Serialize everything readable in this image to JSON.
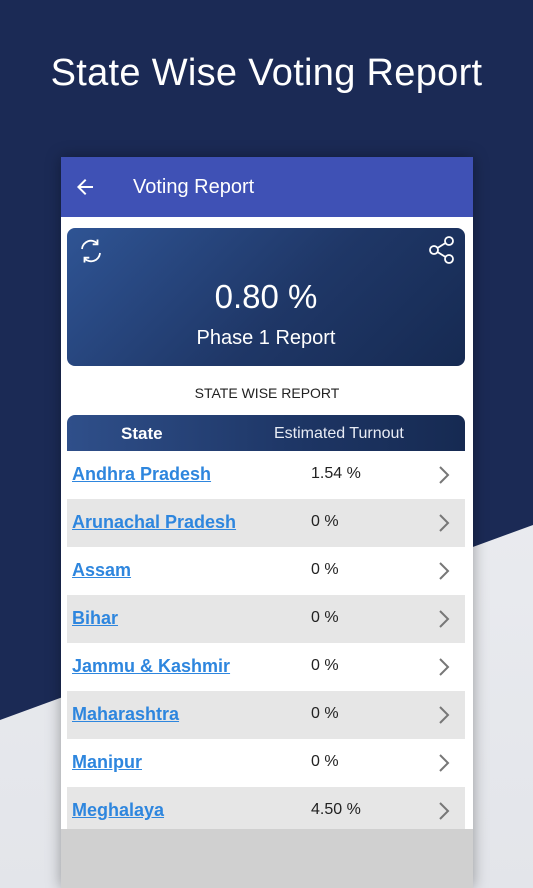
{
  "promo": {
    "title": "State Wise Voting Report"
  },
  "appbar": {
    "title": "Voting Report",
    "back_icon": "arrow-left-icon"
  },
  "summary": {
    "turnout": "0.80 %",
    "phase_label": "Phase 1 Report",
    "refresh_icon": "refresh-icon",
    "share_icon": "share-icon"
  },
  "section": {
    "title": "STATE WISE REPORT"
  },
  "table": {
    "headers": {
      "state": "State",
      "turnout": "Estimated Turnout"
    },
    "rows": [
      {
        "state": "Andhra Pradesh",
        "turnout": "1.54 %"
      },
      {
        "state": "Arunachal Pradesh",
        "turnout": "0 %"
      },
      {
        "state": "Assam",
        "turnout": "0 %"
      },
      {
        "state": "Bihar",
        "turnout": "0 %"
      },
      {
        "state": "Jammu & Kashmir",
        "turnout": "0 %"
      },
      {
        "state": "Maharashtra",
        "turnout": "0 %"
      },
      {
        "state": "Manipur",
        "turnout": "0 %"
      },
      {
        "state": "Meghalaya",
        "turnout": "4.50 %"
      }
    ]
  },
  "colors": {
    "appbar": "#3f51b5",
    "background": "#1b2a55",
    "link": "#2e86de"
  }
}
